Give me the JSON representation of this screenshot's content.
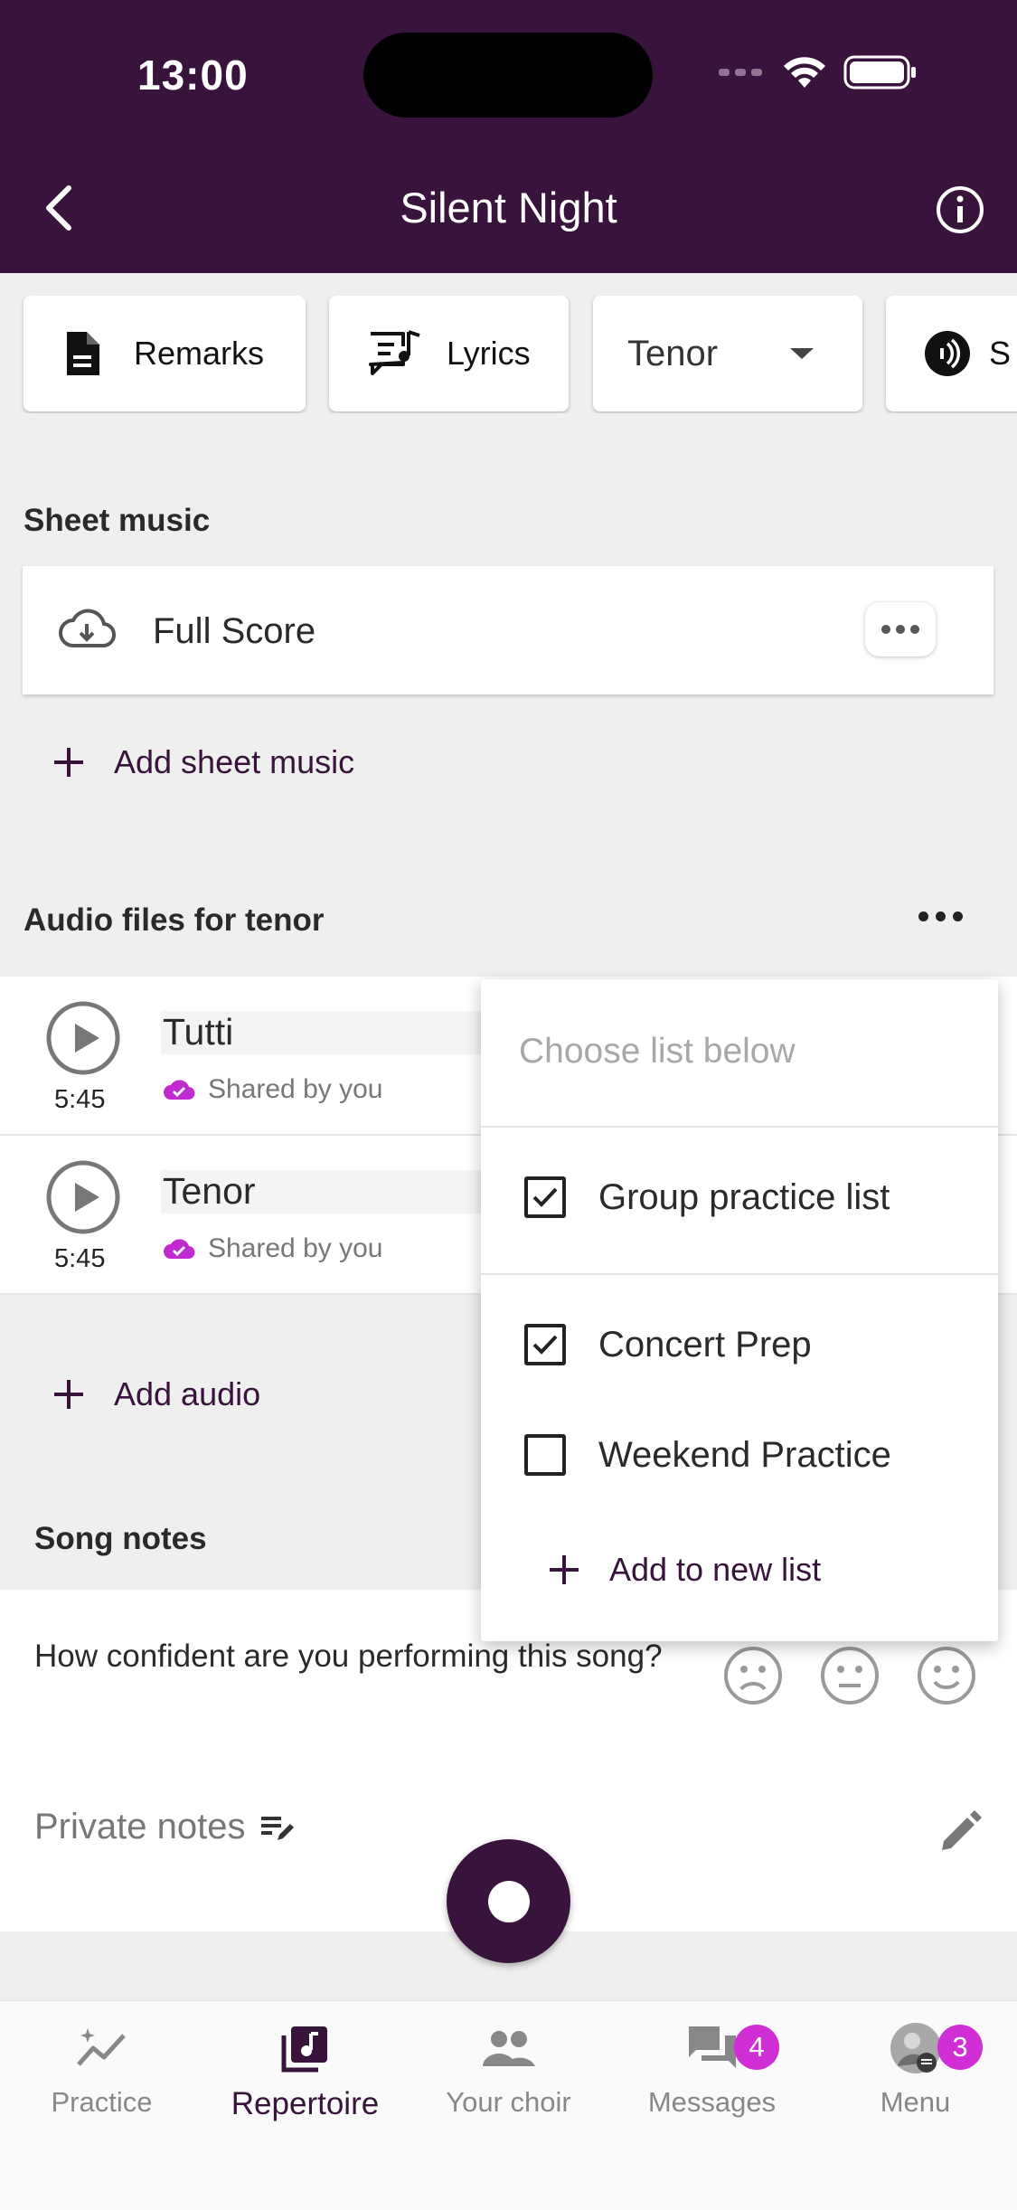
{
  "status_bar": {
    "time": "13:00"
  },
  "header": {
    "title": "Silent Night"
  },
  "chips": {
    "remarks": "Remarks",
    "lyrics": "Lyrics",
    "voice": "Tenor",
    "partial": "S"
  },
  "sheet_music": {
    "title": "Sheet music",
    "items": [
      {
        "name": "Full Score"
      }
    ],
    "add_label": "Add sheet music"
  },
  "audio": {
    "title": "Audio files for tenor",
    "tracks": [
      {
        "name": "Tutti",
        "duration": "5:45",
        "shared": "Shared by you"
      },
      {
        "name": "Tenor",
        "duration": "5:45",
        "shared": "Shared by you"
      }
    ],
    "add_label": "Add audio"
  },
  "song_notes": {
    "title": "Song notes",
    "question": "How confident are you performing this song?",
    "private_label": "Private notes"
  },
  "dropdown": {
    "header": "Choose list below",
    "items": [
      {
        "label": "Group practice list",
        "checked": true
      },
      {
        "label": "Concert Prep",
        "checked": true
      },
      {
        "label": "Weekend Practice",
        "checked": false
      }
    ],
    "add_label": "Add to new list"
  },
  "nav": {
    "items": [
      {
        "label": "Practice",
        "icon": "practice-trend-icon"
      },
      {
        "label": "Repertoire",
        "icon": "music-note-icon"
      },
      {
        "label": "Your choir",
        "icon": "people-icon"
      },
      {
        "label": "Messages",
        "icon": "chat-icon",
        "badge": "4"
      },
      {
        "label": "Menu",
        "icon": "avatar",
        "badge": "3"
      }
    ]
  },
  "colors": {
    "brand": "#38133b",
    "badge": "#d02fd6"
  }
}
